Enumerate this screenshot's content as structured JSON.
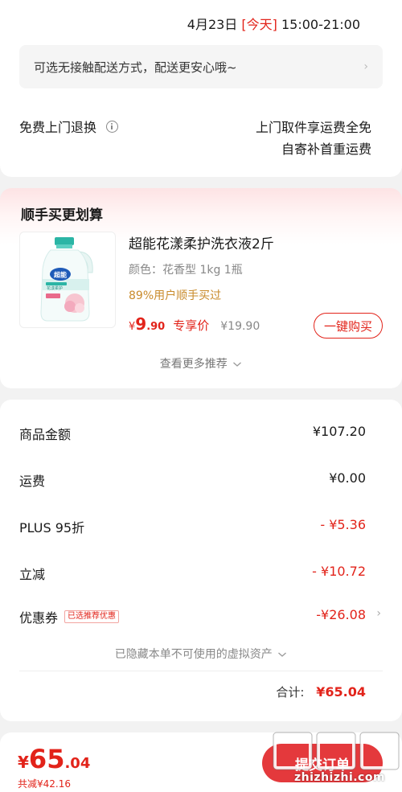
{
  "delivery": {
    "date": "4月23日",
    "today_tag": "[今天]",
    "time_window": "15:00-21:00",
    "contactless_text": "可选无接触配送方式，配送更安心哦~",
    "chevron": "›"
  },
  "returns": {
    "label": "免费上门退换",
    "line1": "上门取件享运费全免",
    "line2": "自寄补首重运费"
  },
  "recommend": {
    "title": "顺手买更划算",
    "product_name": "超能花漾柔护洗衣液2斤",
    "spec": "颜色：花香型 1kg 1瓶",
    "social_proof": "89%用户顺手买过",
    "price_symbol": "¥",
    "price_int": "9",
    "price_dec": ".90",
    "price_tag": "专享价",
    "orig_price": "¥19.90",
    "buy_button": "一键购买",
    "more_link": "查看更多推荐",
    "product_image_brand": "超能",
    "product_image_sub": "花漾柔护"
  },
  "summary": {
    "rows": [
      {
        "label": "商品金额",
        "value": "¥107.20",
        "red": false
      },
      {
        "label": "运费",
        "value": "¥0.00",
        "red": false
      },
      {
        "label": "PLUS 95折",
        "value": "- ¥5.36",
        "red": true
      },
      {
        "label": "立减",
        "value": "- ¥10.72",
        "red": true
      },
      {
        "label": "优惠券",
        "value": "-¥26.08",
        "red": true,
        "badge": "已选推荐优惠",
        "chevron": "›"
      }
    ],
    "hidden_assets": "已隐藏本单不可使用的虚拟资产",
    "total_label": "合计:",
    "total_value": "¥65.04"
  },
  "bottom": {
    "price_symbol": "¥",
    "price_int": "65",
    "price_dec": ".04",
    "saved": "共减¥42.16",
    "submit": "提交订单"
  },
  "watermark": {
    "brand": "值值值",
    "domain": "zhizhizhi.com"
  },
  "colors": {
    "accent_red": "#e2231a",
    "social_orange": "#c98b2c",
    "submit_bg": "#e4393c"
  }
}
